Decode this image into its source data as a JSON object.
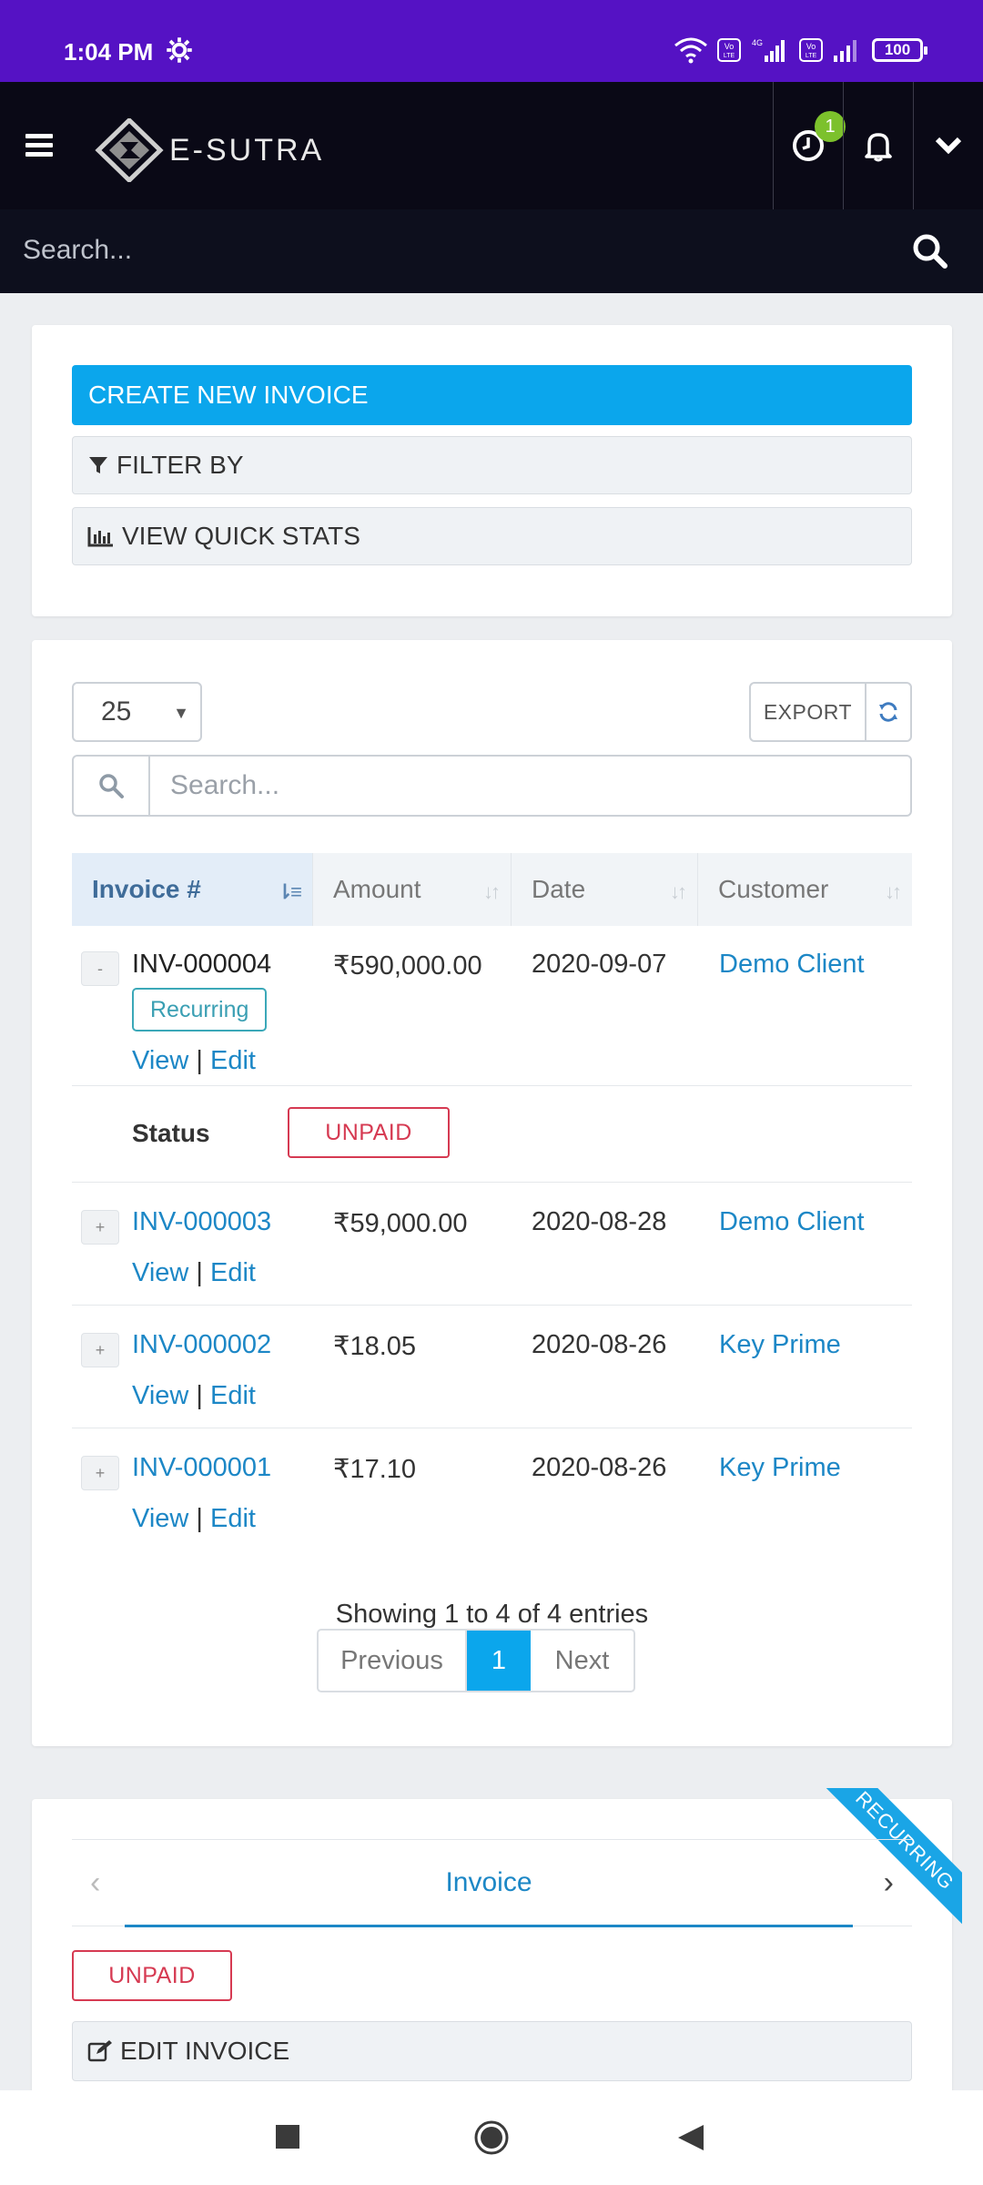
{
  "status_bar": {
    "time": "1:04 PM",
    "battery": "100"
  },
  "header": {
    "brand": "E-SUTRA",
    "timer_badge": "1"
  },
  "global_search": {
    "placeholder": "Search..."
  },
  "actions": {
    "create": "CREATE NEW INVOICE",
    "filter": "FILTER BY",
    "stats": "VIEW QUICK STATS"
  },
  "table_controls": {
    "page_length": "25",
    "export": "EXPORT",
    "search_placeholder": "Search..."
  },
  "columns": [
    "Invoice #",
    "Amount",
    "Date",
    "Customer"
  ],
  "rows": [
    {
      "toggle": "-",
      "invoice": "INV-000004",
      "amount": "₹590,000.00",
      "date": "2020-09-07",
      "customer": "Demo Client",
      "tag": "Recurring",
      "view": "View",
      "sep": "|",
      "edit": "Edit"
    },
    {
      "toggle": "+",
      "invoice": "INV-000003",
      "amount": "₹59,000.00",
      "date": "2020-08-28",
      "customer": "Demo Client",
      "view": "View",
      "sep": "|",
      "edit": "Edit"
    },
    {
      "toggle": "+",
      "invoice": "INV-000002",
      "amount": "₹18.05",
      "date": "2020-08-26",
      "customer": "Key Prime",
      "view": "View",
      "sep": "|",
      "edit": "Edit"
    },
    {
      "toggle": "+",
      "invoice": "INV-000001",
      "amount": "₹17.10",
      "date": "2020-08-26",
      "customer": "Key Prime",
      "view": "View",
      "sep": "|",
      "edit": "Edit"
    }
  ],
  "expanded": {
    "label": "Status",
    "value": "UNPAID"
  },
  "pagination": {
    "info": "Showing 1 to 4 of 4 entries",
    "previous": "Previous",
    "current": "1",
    "next": "Next"
  },
  "detail": {
    "ribbon": "RECURRING",
    "tab": "Invoice",
    "status": "UNPAID",
    "edit": "EDIT INVOICE"
  },
  "colors": {
    "status_bar": "#5512c4",
    "header": "#0a0916",
    "primary": "#0ba6ec",
    "link": "#1c87c6",
    "danger": "#d63a52"
  }
}
